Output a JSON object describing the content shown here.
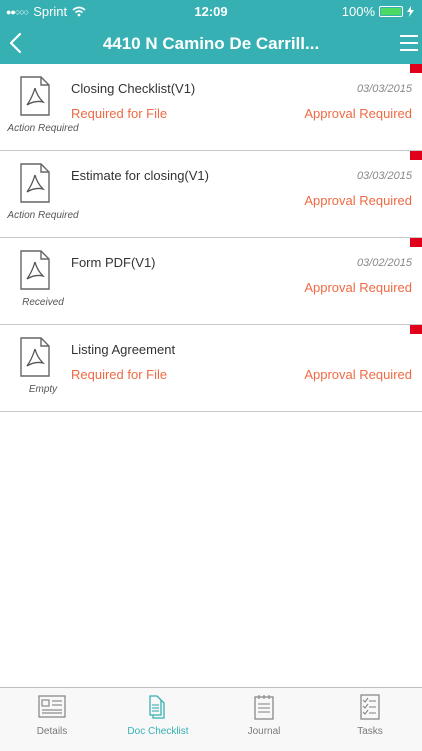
{
  "status_bar": {
    "carrier": "Sprint",
    "time": "12:09",
    "battery": "100%"
  },
  "nav": {
    "title": "4410 N Camino De Carrill..."
  },
  "documents": [
    {
      "name": "Closing Checklist(V1)",
      "date": "03/03/2015",
      "status": "Action Required",
      "required_text": "Required for File",
      "approval_text": "Approval Required"
    },
    {
      "name": "Estimate for closing(V1)",
      "date": "03/03/2015",
      "status": "Action Required",
      "required_text": "",
      "approval_text": "Approval Required"
    },
    {
      "name": "Form PDF(V1)",
      "date": "03/02/2015",
      "status": "Received",
      "required_text": "",
      "approval_text": "Approval Required"
    },
    {
      "name": "Listing Agreement",
      "date": "",
      "status": "Empty",
      "required_text": "Required for File",
      "approval_text": "Approval Required"
    }
  ],
  "tabs": [
    {
      "label": "Details",
      "icon": "details-icon"
    },
    {
      "label": "Doc Checklist",
      "icon": "doc-checklist-icon",
      "active": true
    },
    {
      "label": "Journal",
      "icon": "journal-icon"
    },
    {
      "label": "Tasks",
      "icon": "tasks-icon"
    }
  ],
  "colors": {
    "header": "#36b0b3",
    "accent": "#ef6a44",
    "flag": "#e0001a"
  }
}
